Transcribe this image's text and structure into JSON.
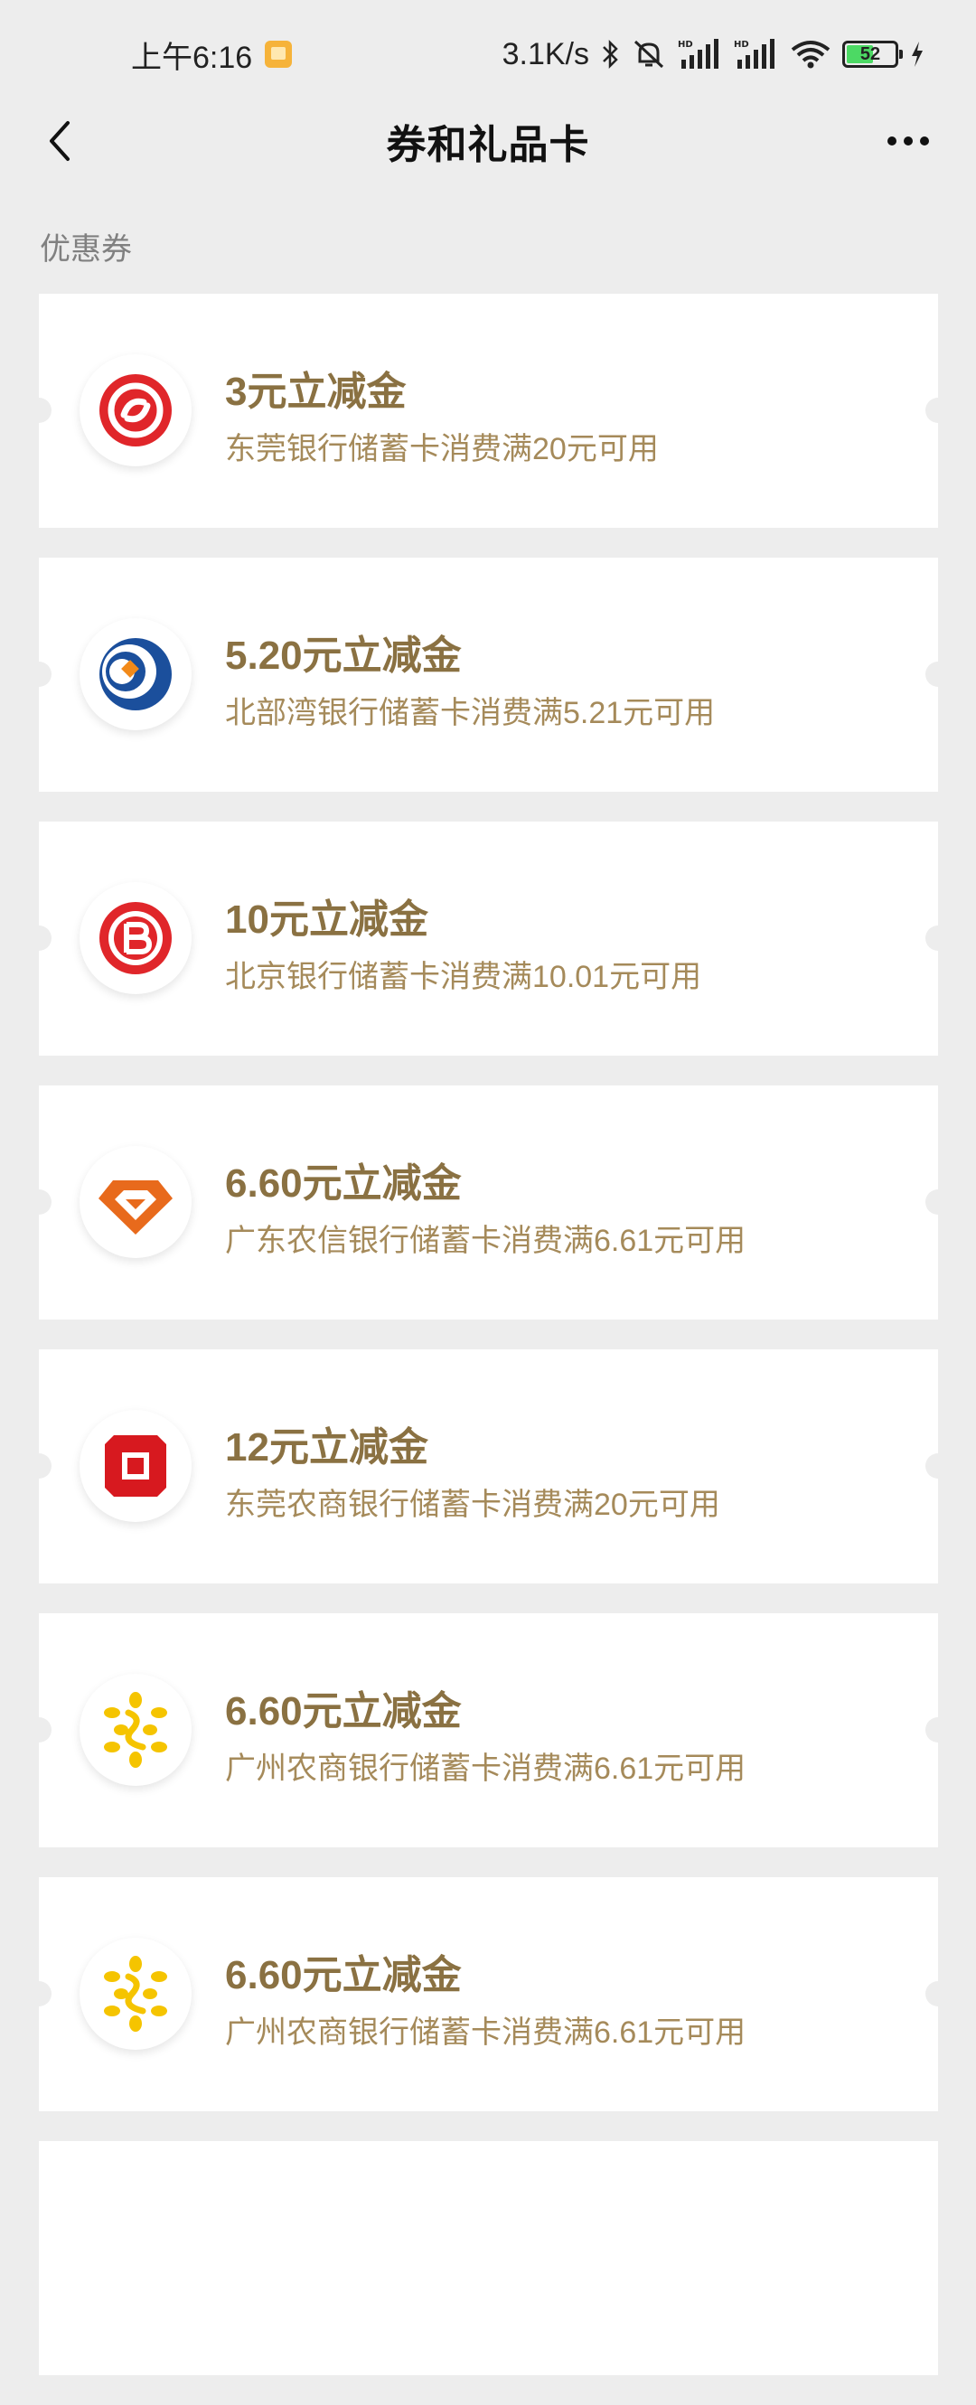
{
  "status_bar": {
    "time": "上午6:16",
    "network_speed": "3.1K/s",
    "battery_level": "52"
  },
  "header": {
    "title": "券和礼品卡"
  },
  "section": {
    "label": "优惠券"
  },
  "coupons": [
    {
      "title": "3元立减金",
      "desc": "东莞银行储蓄卡消费满20元可用",
      "logo": "dongguan-bank-logo-icon"
    },
    {
      "title": "5.20元立减金",
      "desc": "北部湾银行储蓄卡消费满5.21元可用",
      "logo": "beibuwan-bank-logo-icon"
    },
    {
      "title": "10元立减金",
      "desc": "北京银行储蓄卡消费满10.01元可用",
      "logo": "bank-of-beijing-logo-icon"
    },
    {
      "title": "6.60元立减金",
      "desc": "广东农信银行储蓄卡消费满6.61元可用",
      "logo": "guangdong-rural-credit-logo-icon"
    },
    {
      "title": "12元立减金",
      "desc": "东莞农商银行储蓄卡消费满20元可用",
      "logo": "dongguan-rural-commercial-bank-logo-icon"
    },
    {
      "title": "6.60元立减金",
      "desc": "广州农商银行储蓄卡消费满6.61元可用",
      "logo": "guangzhou-rural-commercial-bank-logo-icon"
    },
    {
      "title": "6.60元立减金",
      "desc": "广州农商银行储蓄卡消费满6.61元可用",
      "logo": "guangzhou-rural-commercial-bank-logo-icon"
    }
  ],
  "colors": {
    "coupon_title": "#8a7142",
    "coupon_desc": "#a58a5a",
    "background": "#ededed"
  }
}
